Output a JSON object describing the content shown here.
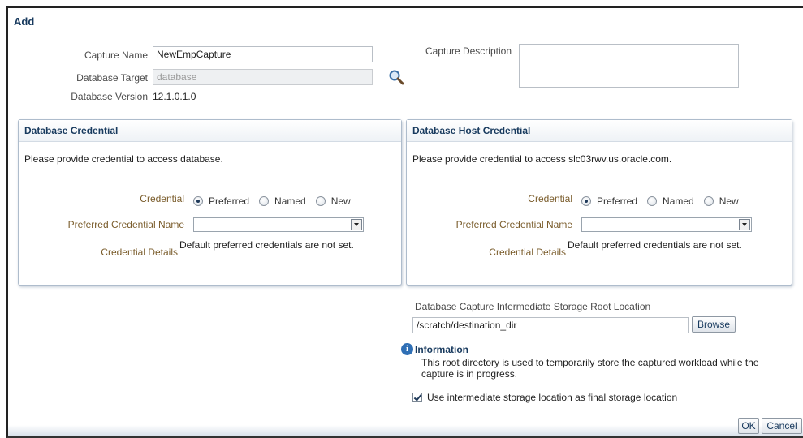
{
  "dialog": {
    "title": "Add"
  },
  "capture": {
    "name_label": "Capture Name",
    "name_value": "NewEmpCapture",
    "target_label": "Database Target",
    "target_value": "database",
    "version_label": "Database Version",
    "version_value": "12.1.0.1.0",
    "description_label": "Capture Description",
    "description_value": ""
  },
  "db_credential": {
    "title": "Database Credential",
    "prompt": "Please provide credential to access database.",
    "credential_label": "Credential",
    "options": [
      "Preferred",
      "Named",
      "New"
    ],
    "selected": "Preferred",
    "preferred_name_label": "Preferred Credential Name",
    "preferred_name_value": "",
    "details_label": "Credential Details",
    "details_value": "Default preferred credentials are not set."
  },
  "host_credential": {
    "title": "Database Host Credential",
    "prompt": "Please provide credential to access slc03rwv.us.oracle.com.",
    "credential_label": "Credential",
    "options": [
      "Preferred",
      "Named",
      "New"
    ],
    "selected": "Preferred",
    "preferred_name_label": "Preferred Credential Name",
    "preferred_name_value": "",
    "details_label": "Credential Details",
    "details_value": "Default preferred credentials are not set."
  },
  "storage": {
    "label": "Database Capture Intermediate Storage Root Location",
    "path_value": "/scratch/destination_dir",
    "browse_label": "Browse",
    "info_title": "Information",
    "info_text": "This root directory is used to temporarily store the captured workload while the capture is in progress.",
    "final_checkbox_label": "Use intermediate storage location as final storage location",
    "final_checked": true
  },
  "actions": {
    "ok_label": "OK",
    "cancel_label": "Cancel"
  },
  "colors": {
    "accent": "#183a5e",
    "label_brown": "#7a5c2b",
    "panel_border": "#aebccc"
  },
  "icons": {
    "target_search": "magnifier-icon",
    "info": "info-icon"
  }
}
